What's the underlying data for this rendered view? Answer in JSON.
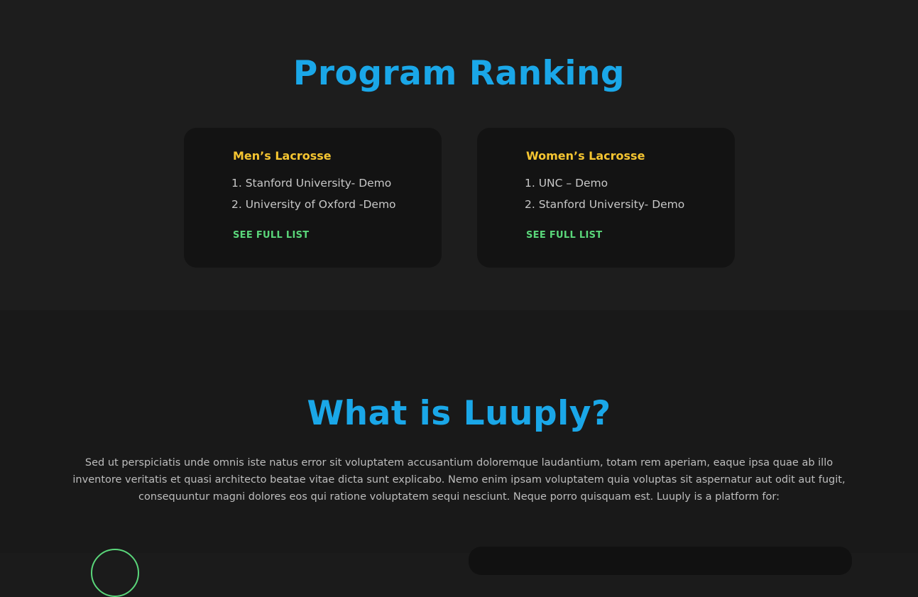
{
  "ranking": {
    "title": "Program Ranking",
    "cards": [
      {
        "heading": "Men’s Lacrosse",
        "items": [
          "1. Stanford University- Demo",
          "2. University of Oxford -Demo"
        ],
        "link": "SEE FULL LIST"
      },
      {
        "heading": "Women’s Lacrosse",
        "items": [
          "1. UNC – Demo",
          "2. Stanford University- Demo"
        ],
        "link": "SEE FULL LIST"
      }
    ]
  },
  "about": {
    "title": "What is Luuply?",
    "text": "Sed ut perspiciatis unde omnis iste natus error sit voluptatem accusantium doloremque laudantium, totam rem aperiam, eaque ipsa quae ab illo inventore veritatis et quasi architecto beatae vitae dicta sunt explicabo. Nemo enim ipsam voluptatem quia voluptas sit aspernatur aut odit aut fugit, consequuntur magni dolores eos qui ratione voluptatem sequi nesciunt. Neque porro quisquam est. Luuply is a platform for:"
  },
  "colors": {
    "title": "#1aa7e8",
    "heading": "#f5c531",
    "link": "#5ad67a"
  }
}
